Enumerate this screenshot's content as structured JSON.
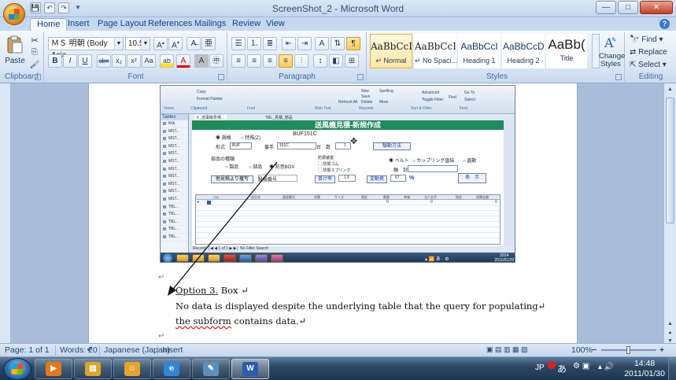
{
  "window": {
    "title": "ScreenShot_2 - Microsoft Word",
    "minimize": "—",
    "maximize": "□",
    "close": "✕",
    "help": "?"
  },
  "qat": [
    "💾",
    "↶",
    "↷",
    "▾"
  ],
  "tabs": [
    "Home",
    "Insert",
    "Page Layout",
    "References",
    "Mailings",
    "Review",
    "View"
  ],
  "ribbon": {
    "clipboard": {
      "label": "Clipboard",
      "paste": "Paste"
    },
    "font": {
      "label": "Font",
      "name": "ＭＳ 明朝 (Body Asia",
      "size": "10.5",
      "buttons": [
        "B",
        "I",
        "U",
        "abe",
        "x₂",
        "x²",
        "Aa",
        "ab",
        "A",
        "A"
      ]
    },
    "paragraph": {
      "label": "Paragraph"
    },
    "styles": {
      "label": "Styles",
      "items": [
        {
          "sample": "AaBbCcI",
          "name": "↵ Normal"
        },
        {
          "sample": "AaBbCcI",
          "name": "↵ No Spaci..."
        },
        {
          "sample": "AaBbCcI",
          "name": "Heading 1"
        },
        {
          "sample": "AaBbCcD",
          "name": "Heading 2"
        },
        {
          "sample": "AaBb(",
          "name": "Title"
        }
      ],
      "change_styles": "Change Styles"
    },
    "editing": {
      "label": "Editing",
      "find": "Find",
      "replace": "Replace",
      "select": "Select"
    }
  },
  "embedded": {
    "ribbon_groups": [
      "Views",
      "Clipboard",
      "Font",
      "Rich Text",
      "Records",
      "Sort & Filter",
      "Find"
    ],
    "ribbon_items": [
      "Copy",
      "Format Painter",
      "Refresh All",
      "New",
      "Save",
      "Delete",
      "Spelling",
      "More",
      "Advanced",
      "Toggle Filter",
      "Find",
      "Go To",
      "Select"
    ],
    "nav_header": "Tables",
    "nav_items": [
      "Kkk",
      "MST...",
      "MST...",
      "MST...",
      "MST...",
      "MST...",
      "MST...",
      "MST...",
      "MST...",
      "MST...",
      "MST...",
      "TBL...",
      "TBL...",
      "TBL...",
      "TBL...",
      "TBL..."
    ],
    "doc_tabs": [
      "F_送風機見積...",
      "TBL_見積_部品"
    ],
    "form": {
      "header": "送風機見積-新規作成",
      "opt_standard": "◉ 規格",
      "opt_special": "○ 特殊(Z)",
      "code": "BUF151C",
      "type_label": "形式",
      "type_value": "BUF",
      "num_label": "番手",
      "num_value": "151C",
      "count_label": "台　数",
      "count_value": "1",
      "drive_button": "駆動方法",
      "parts_label": "部品の種類",
      "parts_options": [
        "○ 製品",
        "○ 部品",
        "◉ 防音BOX"
      ],
      "vib_label": "防振装置",
      "vib_options": [
        "▢ 防振ゴム",
        "▢ 防振スプリング"
      ],
      "drive_options": [
        "◉ ベルト",
        "○ カップリング直結",
        "○ 直動"
      ],
      "shaft_label": "軸　封",
      "copy_button": "他見積より複写",
      "ref_label": "見積番号",
      "rate_button": "掛け率",
      "rate_value": "1.5",
      "labor_button": "変動費",
      "labor_value": "67",
      "pct": "%",
      "show_button": "表　示",
      "grid_headers": [
        "Cnk",
        "部品名",
        "図面番号",
        "材質",
        "サイズ",
        "指定",
        "数量",
        "単価",
        "法人名不",
        "指定",
        "見積金額"
      ],
      "grid_zeros": [
        "0",
        "0",
        "0"
      ]
    },
    "status": "Record: │◀ ◀ 1 of 1 ▶ ▶│  No Filter   Search",
    "clock_time": "2014",
    "clock_date": "2011/01/29",
    "tray_text": "▴ 📶 あ · ⚙"
  },
  "document": {
    "para_marks": [
      "↵",
      "↵",
      "↵"
    ],
    "line1_underlined": "Option 3.",
    "line1_rest": "  Box ↵",
    "line2": "No data is displayed despite the underlying table that the query for populating↵",
    "line3_underlined": "the subform",
    "line3_rest": " contains data.↵"
  },
  "statusbar": {
    "page": "Page: 1 of 1",
    "words": "Words: 20",
    "language": "Japanese (Japan)",
    "mode": "Insert",
    "zoom": "100%",
    "zoom_minus": "−",
    "zoom_plus": "+"
  },
  "taskbar": {
    "apps": [
      {
        "name": "media",
        "glyph": "▶",
        "color": "#e0791a"
      },
      {
        "name": "explorer",
        "glyph": "▤",
        "color": "#d9a52b"
      },
      {
        "name": "messenger",
        "glyph": "☺",
        "color": "#e5a42f"
      },
      {
        "name": "ie",
        "glyph": "e",
        "color": "#2f86d6"
      },
      {
        "name": "notes",
        "glyph": "✎",
        "color": "#5b8fb9"
      },
      {
        "name": "word",
        "glyph": "W",
        "color": "#2a5cab"
      }
    ],
    "lang": "JP",
    "ime": "あ",
    "tray_icons": "▴ 🔊",
    "time": "14:48",
    "date": "2011/01/30"
  }
}
